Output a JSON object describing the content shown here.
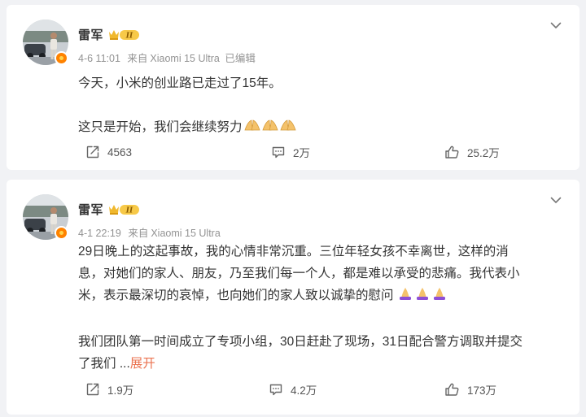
{
  "posts": [
    {
      "author": "雷军",
      "date": "4-6 11:01",
      "source_prefix": "来自",
      "device": "Xiaomi 15 Ultra",
      "edited": "已编辑",
      "paragraphs": [
        "今天，小米的创业路已走过了15年。",
        "",
        "这只是开始，我们会继续努力"
      ],
      "emoji_icon": "folded-hands-icon",
      "reposts": "4563",
      "comments": "2万",
      "likes": "25.2万"
    },
    {
      "author": "雷军",
      "date": "4-1 22:19",
      "source_prefix": "来自",
      "device": "Xiaomi 15 Ultra",
      "edited": "",
      "paragraphs": [
        "29日晚上的这起事故，我的心情非常沉重。三位年轻女孩不幸离世，这样的消",
        "息，对她们的家人、朋友，乃至我们每一个人，都是难以承受的悲痛。我代表小",
        "米，表示最深切的哀悼，也向她们的家人致以诚挚的慰问",
        "",
        "我们团队第一时间成立了专项小组，30日赶赴了现场，31日配合警方调取并提交",
        "了我们"
      ],
      "ellipsis": "...",
      "expand_label": "展开",
      "emoji_icon": "praying-hands-icon",
      "reposts": "1.9万",
      "comments": "4.2万",
      "likes": "173万"
    }
  ],
  "colors": {
    "page_bg": "#f1f2f5",
    "card_bg": "#ffffff",
    "meta_text": "#939393",
    "link_orange": "#eb7350",
    "badge_gold": "#f0b82d",
    "verified_orange": "#ff8200"
  },
  "icons": {
    "repost": "repost-icon",
    "comment": "comment-icon",
    "like": "like-icon",
    "menu": "chevron-down-icon",
    "level_badge": "member-level-badge",
    "verified": "verified-badge-icon"
  },
  "level_badge_text": "II"
}
